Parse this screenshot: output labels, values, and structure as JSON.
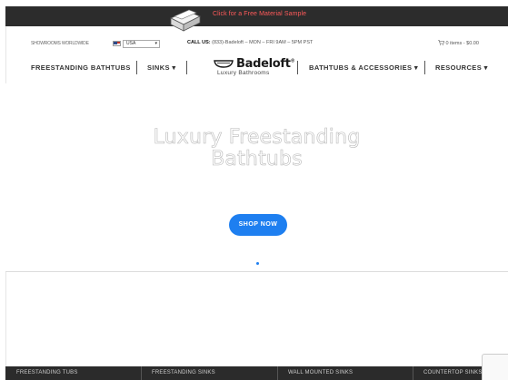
{
  "promo": {
    "text": "Click for a Free Material Sample"
  },
  "util": {
    "showrooms": "SHOWROOMS WORLDWIDE",
    "country": "USA",
    "callus_label": "CALL US:",
    "callus_text": " (833)-Badeloft – MON – FRI 9AM – 5PM PST",
    "cart": "0 items - $0.00"
  },
  "nav": {
    "items": [
      {
        "label": "FREESTANDING BATHTUBS"
      },
      {
        "label": "SINKS ▾"
      },
      {
        "label": "BATHTUBS & ACCESSORIES ▾"
      },
      {
        "label": "RESOURCES ▾"
      }
    ],
    "logo": {
      "name": "Badeloft",
      "mark": "®",
      "subtitle": "Luxury Bathrooms"
    }
  },
  "hero": {
    "title_line1": "Luxury Freestanding",
    "title_line2": "Bathtubs",
    "button": "SHOP NOW"
  },
  "categories": [
    {
      "label": "FREESTANDING TUBS"
    },
    {
      "label": "FREESTANDING SINKS"
    },
    {
      "label": "WALL MOUNTED SINKS"
    },
    {
      "label": "COUNTERTOP SINKS"
    }
  ],
  "colors": {
    "accent": "#1e7ff0",
    "promo_bg": "#2c2c2c",
    "promo_text": "#ff5a5a",
    "footer_bg": "#2b2b2b"
  }
}
